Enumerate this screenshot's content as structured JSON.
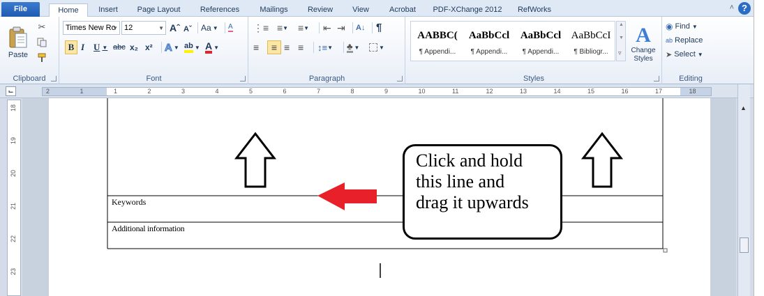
{
  "tabs": {
    "file": "File",
    "home": "Home",
    "insert": "Insert",
    "page_layout": "Page Layout",
    "references": "References",
    "mailings": "Mailings",
    "review": "Review",
    "view": "View",
    "acrobat": "Acrobat",
    "pdfx": "PDF-XChange 2012",
    "refworks": "RefWorks"
  },
  "help": "?",
  "clipboard": {
    "label": "Clipboard",
    "paste": "Paste"
  },
  "font": {
    "label": "Font",
    "family": "Times New Ro",
    "size": "12",
    "bold": "B",
    "italic": "I",
    "underline": "U",
    "strike": "abc",
    "subscript": "x₂",
    "superscript": "x²",
    "grow": "Aˆ",
    "shrink": "Aˇ",
    "case": "Aa",
    "clear": "A",
    "highlight": "ab",
    "color": "A"
  },
  "paragraph": {
    "label": "Paragraph",
    "pilcrow": "¶"
  },
  "styles": {
    "label": "Styles",
    "items": [
      {
        "sample": "AABBC(",
        "name": "¶ Appendi..."
      },
      {
        "sample": "AaBbCcl",
        "name": "¶ Appendi..."
      },
      {
        "sample": "AaBbCcl",
        "name": "¶ Appendi..."
      },
      {
        "sample": "AaBbCcI",
        "name": "¶ Bibliogr..."
      }
    ],
    "change_styles": "Change Styles"
  },
  "editing": {
    "label": "Editing",
    "find": "Find",
    "replace": "Replace",
    "select": "Select"
  },
  "ruler": {
    "h_numbers": [
      "2",
      "1",
      "1",
      "2",
      "3",
      "4",
      "5",
      "6",
      "7",
      "8",
      "9",
      "10",
      "11",
      "12",
      "13",
      "14",
      "15",
      "16",
      "17",
      "18"
    ],
    "v_numbers": [
      "18",
      "19",
      "20",
      "21",
      "22",
      "23"
    ]
  },
  "document": {
    "row_keywords": "Keywords",
    "row_additional": "Additional information",
    "callout_lines": [
      "Click and hold",
      "this line and",
      "drag it upwards"
    ]
  },
  "colors": {
    "arrow_red": "#e8202a",
    "file_tab": "#2a67bd"
  }
}
